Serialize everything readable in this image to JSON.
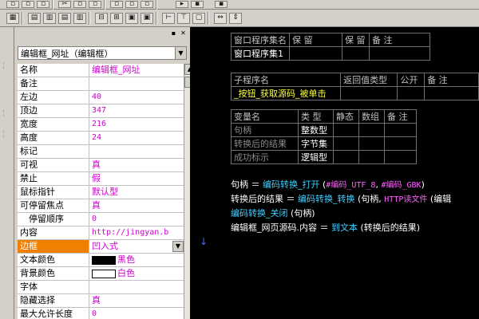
{
  "property_panel": {
    "object_select": "编辑框_网址（编辑框）",
    "rows": [
      {
        "name": "名称",
        "value": "编辑框_网址"
      },
      {
        "name": "备注",
        "value": ""
      },
      {
        "name": "左边",
        "value": "40"
      },
      {
        "name": "顶边",
        "value": "347"
      },
      {
        "name": "宽度",
        "value": "216"
      },
      {
        "name": "高度",
        "value": "24"
      },
      {
        "name": "标记",
        "value": ""
      },
      {
        "name": "可视",
        "value": "真"
      },
      {
        "name": "禁止",
        "value": "假"
      },
      {
        "name": "鼠标指针",
        "value": "默认型"
      },
      {
        "name": "可停留焦点",
        "value": "真"
      },
      {
        "name": "停留顺序",
        "value": "0"
      },
      {
        "name": "内容",
        "value": "http://jingyan.b"
      },
      {
        "name": "边框",
        "value": "凹入式"
      },
      {
        "name": "文本颜色",
        "value": "黑色"
      },
      {
        "name": "背景颜色",
        "value": "白色"
      },
      {
        "name": "字体",
        "value": ""
      },
      {
        "name": "隐藏选择",
        "value": "真"
      },
      {
        "name": "最大允许长度",
        "value": "0"
      }
    ],
    "text_color_swatch": "#000000",
    "bg_color_swatch": "#ffffff"
  },
  "code": {
    "assembly_table": {
      "headers": [
        "窗口程序集名",
        "保 留",
        "保 留",
        "备 注"
      ],
      "row": [
        "窗口程序集1",
        "",
        "",
        ""
      ]
    },
    "sub_table": {
      "headers": [
        "子程序名",
        "返回值类型",
        "公开",
        "备 注"
      ],
      "row": [
        "_按钮_获取源码_被单击",
        "",
        "",
        ""
      ]
    },
    "var_table": {
      "headers": [
        "变量名",
        "类 型",
        "静态",
        "数组",
        "备 注"
      ],
      "rows": [
        [
          "句柄",
          "整数型",
          "",
          "",
          ""
        ],
        [
          "转换后的结果",
          "字节集",
          "",
          "",
          ""
        ],
        [
          "成功标示",
          "逻辑型",
          "",
          "",
          ""
        ]
      ]
    },
    "lines": [
      {
        "a": "句柄 ＝ ",
        "b": "编码转换_打开",
        "c": " (",
        "d": "#编码_UTF_8",
        "e": ", ",
        "f": "#编码_GBK",
        "g": ")"
      },
      {
        "a": "转换后的结果 ＝ ",
        "b": "编码转换_转换",
        "c": " (句柄, ",
        "d": "HTTP读文件",
        "e": " (编辑",
        "f": "",
        "g": ""
      },
      {
        "a": "",
        "b": "编码转换_关闭",
        "c": " (句柄)",
        "d": "",
        "e": "",
        "f": "",
        "g": ""
      },
      {
        "a": "编辑框_网页源码.内容 ＝ ",
        "b": "到文本",
        "c": " (转换后的结果)",
        "d": "",
        "e": "",
        "f": "",
        "g": ""
      }
    ]
  },
  "colors": {
    "toolbar_bg": "#d4d0c8",
    "selected_row": "#f08000",
    "property_value": "#d000d0",
    "code_keyword": "#40d0ff",
    "code_constant": "#ff60ff",
    "table_type": "#ffff40"
  }
}
